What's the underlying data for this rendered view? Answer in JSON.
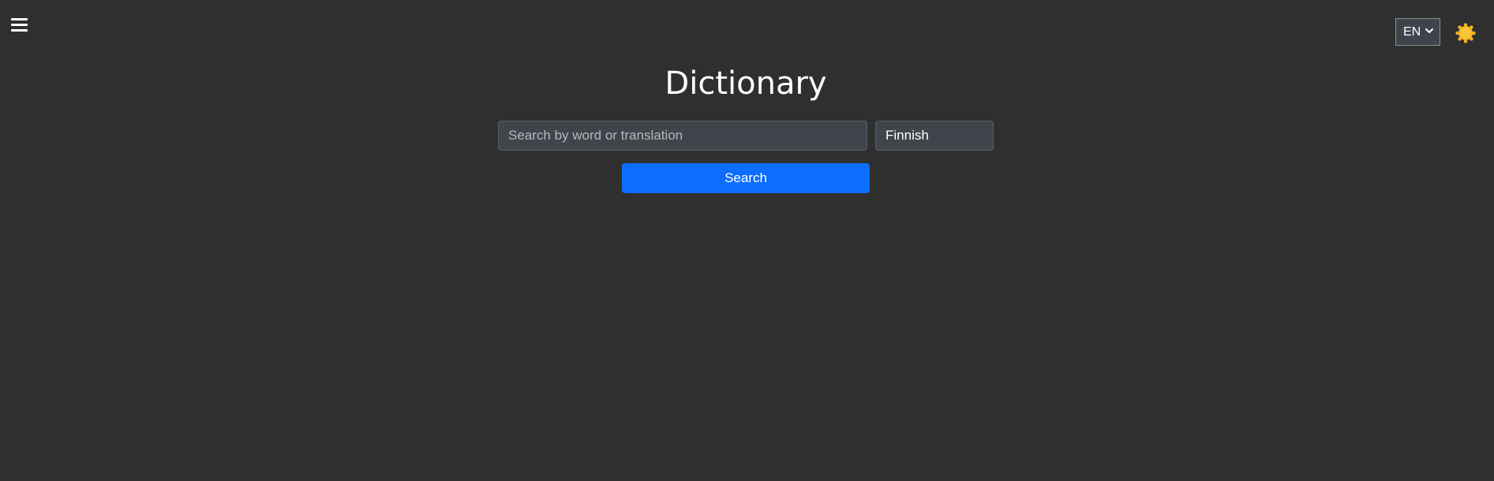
{
  "header": {
    "menu_icon": "hamburger-menu-icon",
    "language_selector": {
      "selected": "EN",
      "icon": "chevron-down-icon"
    },
    "theme_toggle": {
      "icon": "sun-icon",
      "color": "#f5b520"
    }
  },
  "main": {
    "title": "Dictionary",
    "search": {
      "placeholder": "Search by word or translation",
      "value": ""
    },
    "language": {
      "selected": "Finnish"
    },
    "search_button_label": "Search"
  },
  "colors": {
    "background": "#2f2f2f",
    "input_background": "#40444b",
    "accent": "#0d6efd",
    "text": "#ffffff"
  }
}
